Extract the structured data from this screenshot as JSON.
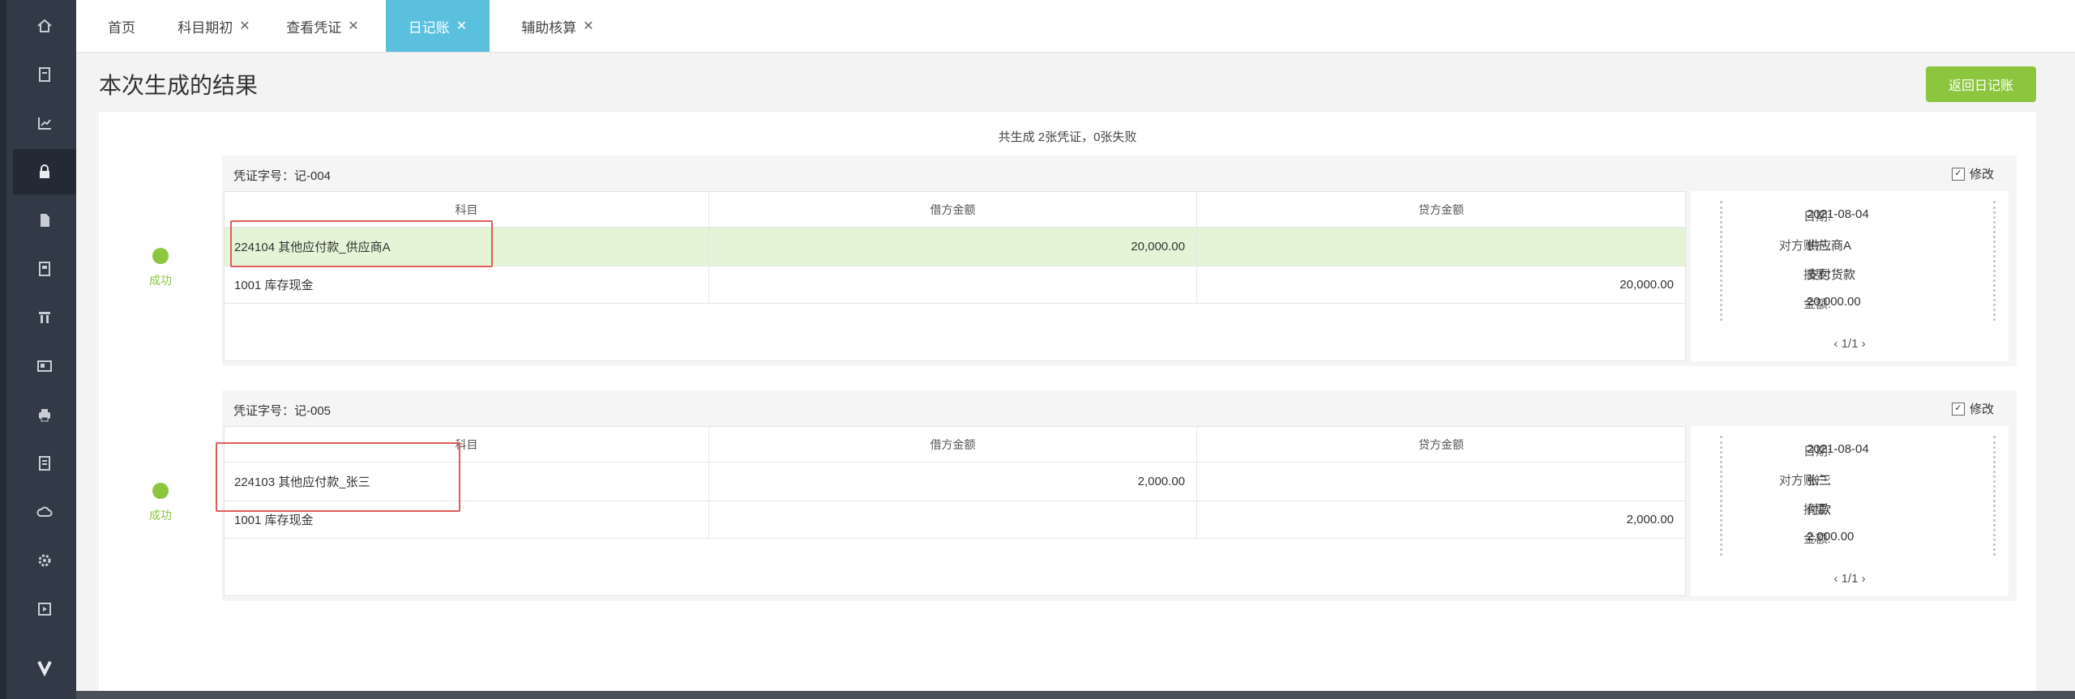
{
  "sidebar": {
    "icons": [
      "home-icon",
      "document-icon",
      "chart-icon",
      "lock-icon",
      "file-icon",
      "report-icon",
      "building-icon",
      "card-icon",
      "print-icon",
      "ledger-icon",
      "cloud-icon",
      "settings-icon",
      "play-icon",
      "v-logo-icon"
    ],
    "active_index": 3
  },
  "tabs": [
    {
      "label": "首页",
      "closable": false
    },
    {
      "label": "科目期初",
      "closable": true
    },
    {
      "label": "查看凭证",
      "closable": true
    },
    {
      "label": "日记账",
      "closable": true,
      "active": true
    },
    {
      "label": "辅助核算",
      "closable": true
    }
  ],
  "page": {
    "title": "本次生成的结果",
    "back_button": "返回日记账",
    "summary": "共生成 2张凭证，0张失败"
  },
  "table_headers": {
    "account": "科目",
    "debit": "借方金额",
    "credit": "贷方金额"
  },
  "edit_label": "修改",
  "edit_check": "✓",
  "vouchers": [
    {
      "number": "凭证字号：记-004",
      "status": "成功",
      "rows": [
        {
          "account": "224104 其他应付款_供应商A",
          "debit": "20,000.00",
          "credit": ""
        },
        {
          "account": "1001 库存现金",
          "debit": "",
          "credit": "20,000.00"
        }
      ],
      "info": {
        "date_label": "日期:",
        "date": "2021-08-04",
        "party_label": "对方账户:",
        "party": "供应商A",
        "summary_label": "摘要:",
        "summary": "支付货款",
        "amount_label": "金额:",
        "amount": "20,000.00"
      },
      "pager": "‹ 1/1 ›"
    },
    {
      "number": "凭证字号：记-005",
      "status": "成功",
      "rows": [
        {
          "account": "224103 其他应付款_张三",
          "debit": "2,000.00",
          "credit": ""
        },
        {
          "account": "1001 库存现金",
          "debit": "",
          "credit": "2,000.00"
        }
      ],
      "info": {
        "date_label": "日期:",
        "date": "2021-08-04",
        "party_label": "对方账户:",
        "party": "张三",
        "summary_label": "摘要:",
        "summary": "付款",
        "amount_label": "金额:",
        "amount": "2,000.00"
      },
      "pager": "‹ 1/1 ›"
    }
  ],
  "colors": {
    "accent": "#5bc0de",
    "success": "#8cc63f",
    "highlight_row": "#e3f5d6",
    "annotation": "#e25b5b"
  }
}
